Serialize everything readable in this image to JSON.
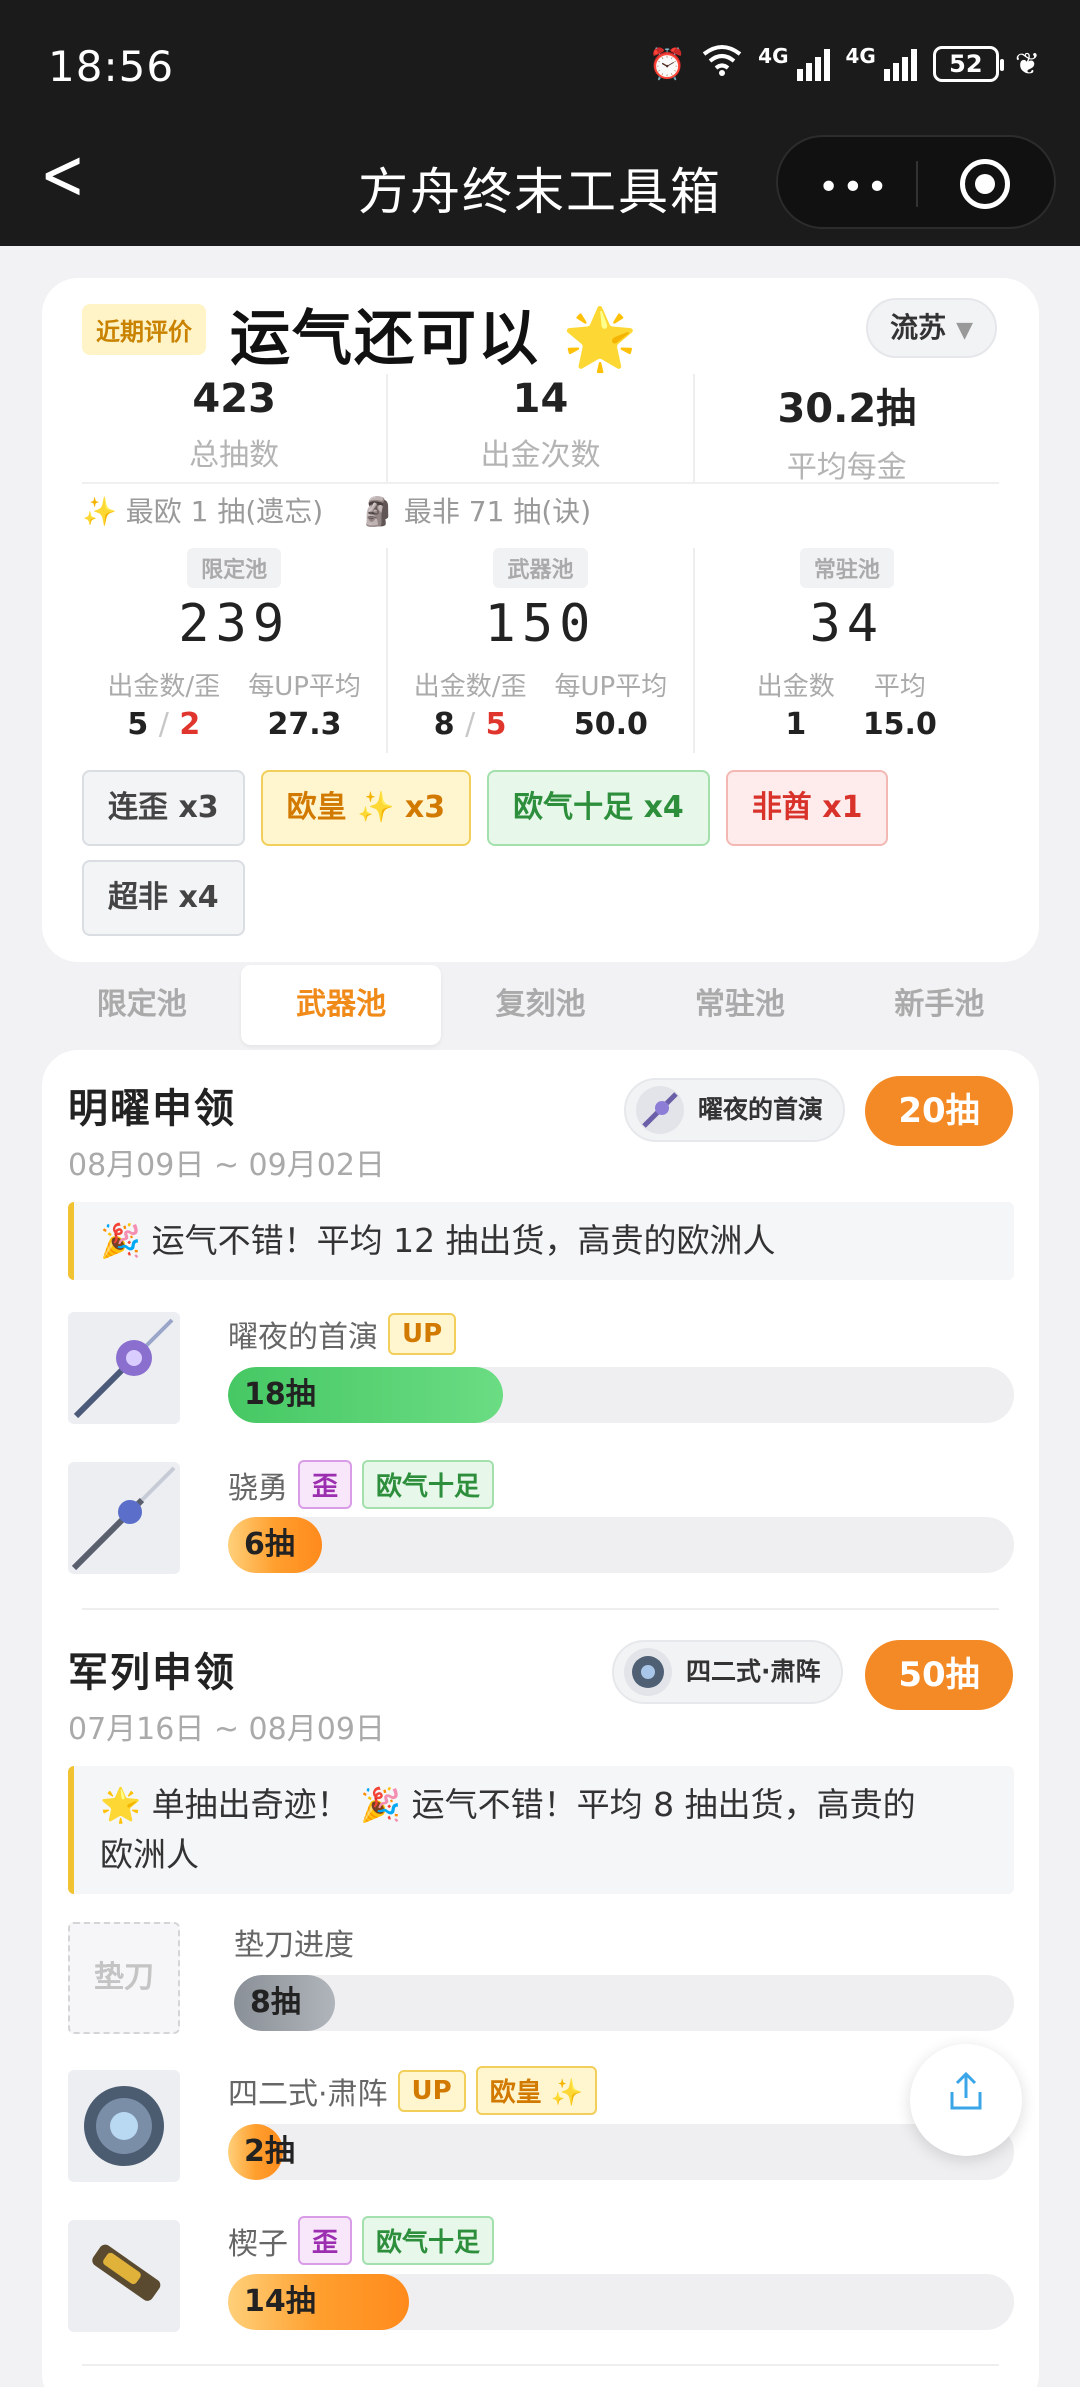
{
  "status": {
    "time": "18:56",
    "net1": "4G",
    "net2": "4G",
    "battery": "52"
  },
  "nav": {
    "title": "方舟终末工具箱",
    "menu": "•••"
  },
  "summary": {
    "tag": "近期评价",
    "headline": "运气还可以 🌟",
    "user": "流苏",
    "stats": [
      {
        "value": "423",
        "label": "总抽数"
      },
      {
        "value": "14",
        "label": "出金次数"
      },
      {
        "value": "30.2抽",
        "label": "平均每金"
      }
    ],
    "best": "✨ 最欧 1 抽(遗忘)",
    "worst": "🗿 最非 71 抽(诀)",
    "pools": [
      {
        "label": "限定池",
        "value": "239",
        "s1_label": "出金数/歪",
        "s1_a": "5",
        "s1_b": "2",
        "s2_label": "每UP平均",
        "s2_value": "27.3"
      },
      {
        "label": "武器池",
        "value": "150",
        "s1_label": "出金数/歪",
        "s1_a": "8",
        "s1_b": "5",
        "s2_label": "每UP平均",
        "s2_value": "50.0"
      },
      {
        "label": "常驻池",
        "value": "34",
        "s1_label": "出金数",
        "s1_a": "1",
        "s2_label": "平均",
        "s2_value": "15.0"
      }
    ],
    "badges": [
      {
        "text": "连歪 x3",
        "style": "gray"
      },
      {
        "text": "欧皇 ✨ x3",
        "style": "yellow"
      },
      {
        "text": "欧气十足 x4",
        "style": "green"
      },
      {
        "text": "非酋 x1",
        "style": "red"
      },
      {
        "text": "超非 x4",
        "style": "gray"
      }
    ]
  },
  "tabs": [
    "限定池",
    "武器池",
    "复刻池",
    "常驻池",
    "新手池"
  ],
  "active_tab": "武器池",
  "banners": [
    {
      "title": "明曜申领",
      "dates": "08月09日 ~ 09月02日",
      "featured": "曜夜的首演",
      "pulls": "20抽",
      "message": "🎉 运气不错！平均 12 抽出货，高贵的欧洲人",
      "items": [
        {
          "name": "曜夜的首演",
          "tags": [
            "UP"
          ],
          "bar": "18抽",
          "progress": 0.33
        },
        {
          "name": "骁勇",
          "tags": [
            "歪",
            "欧气十足"
          ],
          "bar": "6抽",
          "progress": 0.11
        }
      ]
    },
    {
      "title": "军列申领",
      "dates": "07月16日 ~ 08月09日",
      "featured": "四二式·肃阵",
      "pulls": "50抽",
      "message_line1": "🌟 单抽出奇迹！ 🎉 运气不错！平均 8 抽出货，高贵的",
      "message_line2": "欧洲人",
      "pad": {
        "img_label": "垫刀",
        "name": "垫刀进度",
        "bar": "8抽",
        "progress": 0.16
      },
      "items": [
        {
          "name": "四二式·肃阵",
          "tags": [
            "UP",
            "欧皇 ✨"
          ],
          "bar": "2抽",
          "progress": 0.06
        },
        {
          "name": "楔子",
          "tags": [
            "歪",
            "欧气十足"
          ],
          "bar": "14抽",
          "progress": 0.26
        }
      ]
    }
  ],
  "colors": {
    "accent": "#f48a26",
    "green": "#46c864",
    "nav_bg": "#1b1b1b"
  }
}
